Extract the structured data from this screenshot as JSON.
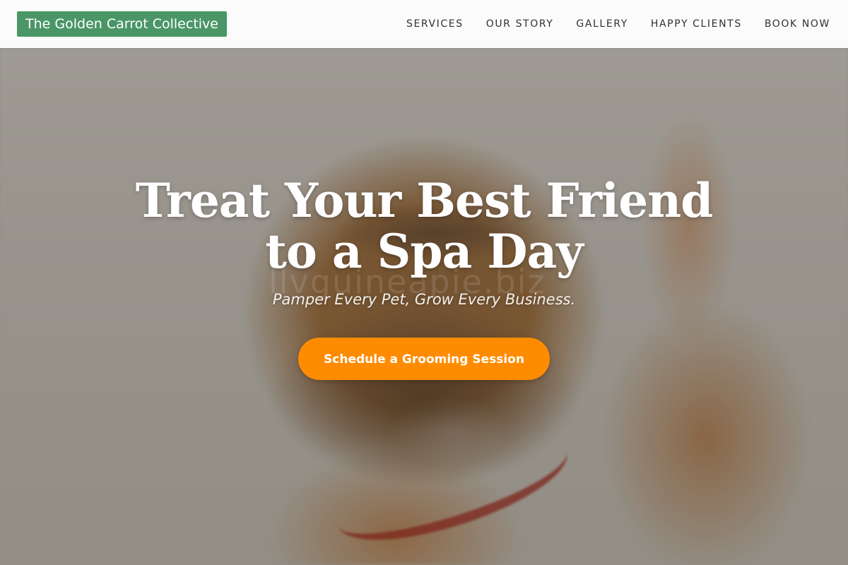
{
  "header": {
    "logo_text": "The Golden Carrot Collective",
    "nav": [
      {
        "label": "SERVICES"
      },
      {
        "label": "OUR STORY"
      },
      {
        "label": "GALLERY"
      },
      {
        "label": "HAPPY CLIENTS"
      },
      {
        "label": "BOOK NOW"
      }
    ]
  },
  "hero": {
    "title": "Treat Your Best Friend to a Spa Day",
    "subtitle": "Pamper Every Pet, Grow Every Business.",
    "cta_label": "Schedule a Grooming Session",
    "watermark": "llvguineapie.biz"
  },
  "colors": {
    "logo_bg": "#4a9666",
    "cta_bg": "#ff8c00",
    "nav_text": "#2f2f38",
    "header_bg": "#ffffff"
  }
}
